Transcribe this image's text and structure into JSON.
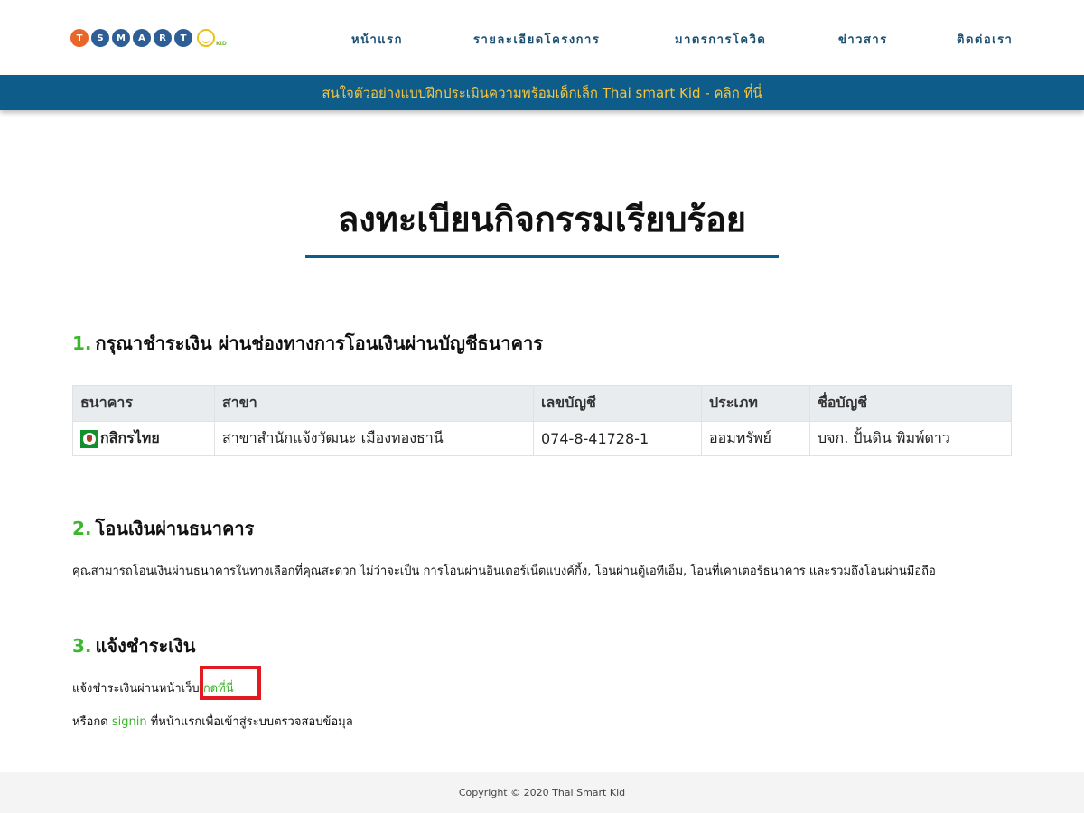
{
  "logo": {
    "letters": [
      {
        "char": "T",
        "color": "#e8662a"
      },
      {
        "char": "S",
        "color": "#2d5f96"
      },
      {
        "char": "M",
        "color": "#2d5f96"
      },
      {
        "char": "A",
        "color": "#2d5f96"
      },
      {
        "char": "R",
        "color": "#2d5f96"
      },
      {
        "char": "T",
        "color": "#2d5f96"
      }
    ],
    "kid": "KID"
  },
  "nav": {
    "items": [
      {
        "label": "หน้าแรก"
      },
      {
        "label": "รายละเอียดโครงการ"
      },
      {
        "label": "มาตรการโควิด"
      },
      {
        "label": "ข่าวสาร"
      },
      {
        "label": "ติดต่อเรา"
      }
    ]
  },
  "promo": {
    "text": "สนใจตัวอย่างแบบฝึกประเมินความพร้อมเด็กเล็ก Thai smart Kid - คลิก ที่นี่"
  },
  "page": {
    "title": "ลงทะเบียนกิจกรรมเรียบร้อย"
  },
  "section1": {
    "number": "1.",
    "heading": "กรุณาชำระเงิน ผ่านช่องทางการโอนเงินผ่านบัญชีธนาคาร",
    "table": {
      "headers": [
        "ธนาคาร",
        "สาขา",
        "เลขบัญชี",
        "ประเภท",
        "ชื่อบัญชี"
      ],
      "rows": [
        {
          "bank": "กสิกรไทย",
          "branch": "สาขาสำนักแจ้งวัฒนะ เมืองทองธานี",
          "account_no": "074-8-41728-1",
          "type": "ออมทรัพย์",
          "account_name": "บจก. ปั้นดิน พิมพ์ดาว"
        }
      ]
    }
  },
  "section2": {
    "number": "2.",
    "heading": "โอนเงินผ่านธนาคาร",
    "body": "คุณสามารถโอนเงินผ่านธนาคารในทางเลือกที่คุณสะดวก ไม่ว่าจะเป็น การโอนผ่านอินเตอร์เน็ตแบงค์กิ้ง, โอนผ่านตู้เอทีเอ็ม, โอนที่เคาเตอร์ธนาคาร และรวมถึงโอนผ่านมือถือ"
  },
  "section3": {
    "number": "3.",
    "heading": "แจ้งชำระเงิน",
    "line1_prefix": "แจ้งชำระเงินผ่านหน้าเว็บ",
    "line1_link": "กดที่นี่",
    "line2_prefix": "หรือกด",
    "line2_link": "signin",
    "line2_suffix": "ที่หน้าแรกเพื่อเข้าสู่ระบบตรวจสอบข้อมุล"
  },
  "footer": {
    "text": "Copyright © 2020 Thai Smart Kid"
  }
}
